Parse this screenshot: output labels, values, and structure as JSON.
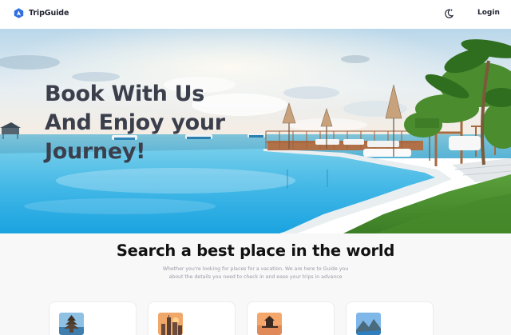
{
  "header": {
    "brand_name": "TripGuide",
    "login_label": "Login",
    "theme_icon": "moon-star-icon",
    "brand_icon": "location-arrow-icon",
    "accent_color": "#2f6fe0"
  },
  "hero": {
    "title_lines": [
      "Book With Us",
      "And Enjoy your",
      "Journey!"
    ]
  },
  "search": {
    "title": "Search a best place in the world",
    "description_lines": [
      "Whether you're looking for places for a vacation. We are here to Guide you",
      "about the details you need to check in and ease your trips in advance"
    ]
  },
  "destinations": [
    {
      "icon": "temple-icon"
    },
    {
      "icon": "city-skyline-icon"
    },
    {
      "icon": "sunset-pier-icon"
    },
    {
      "icon": "mountain-coast-icon"
    }
  ]
}
